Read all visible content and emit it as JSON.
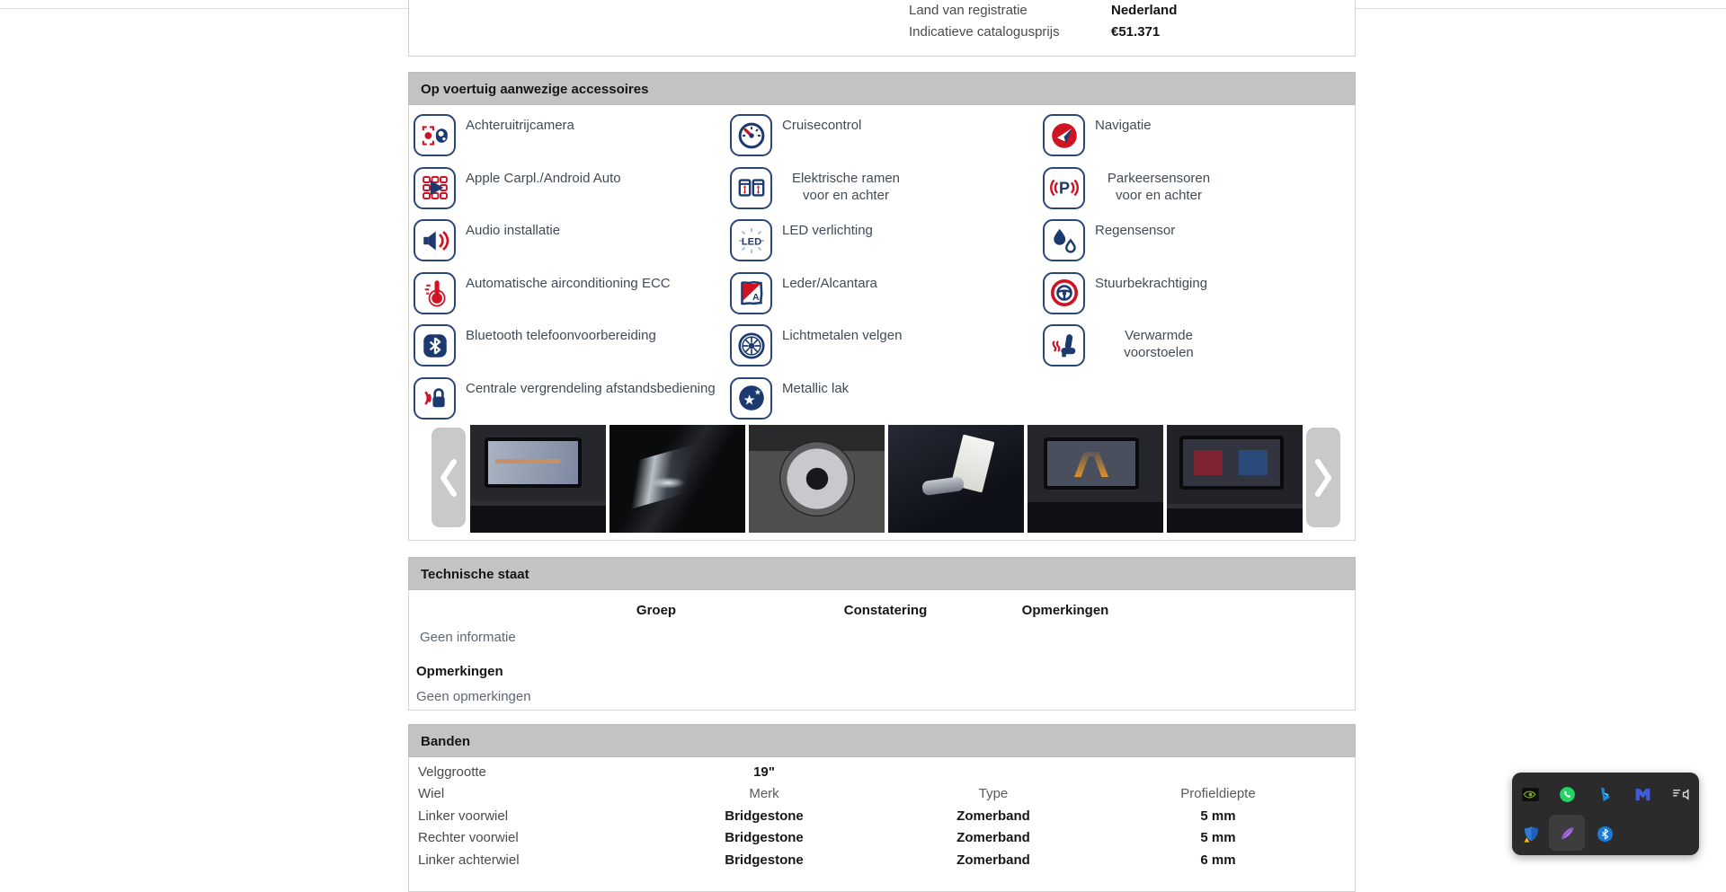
{
  "info_panel": {
    "rows": [
      {
        "label": "Land van registratie",
        "value": "Nederland"
      },
      {
        "label": "Indicatieve catalogusprijs",
        "value": "€51.371"
      }
    ]
  },
  "accessories": {
    "title": "Op voertuig aanwezige accessoires",
    "columns": [
      [
        {
          "label": "Achteruitrijcamera",
          "icon": "rear-camera-icon"
        },
        {
          "label": "Apple Carpl./Android Auto",
          "icon": "carplay-icon"
        },
        {
          "label": "Audio installatie",
          "icon": "audio-speaker-icon"
        },
        {
          "label": "Automatische airconditioning ECC",
          "icon": "climate-thermometer-icon"
        },
        {
          "label": "Bluetooth telefoonvoorbereiding",
          "icon": "bluetooth-icon"
        },
        {
          "label": "Centrale vergrendeling afstandsbediening",
          "icon": "remote-lock-icon"
        }
      ],
      [
        {
          "label": "Cruisecontrol",
          "icon": "cruise-gauge-icon"
        },
        {
          "label": "Elektrische ramen voor en achter",
          "icon": "electric-windows-icon"
        },
        {
          "label": "LED verlichting",
          "icon": "led-light-icon"
        },
        {
          "label": "Leder/Alcantara",
          "icon": "leather-icon"
        },
        {
          "label": "Lichtmetalen velgen",
          "icon": "alloy-wheel-icon"
        },
        {
          "label": "Metallic lak",
          "icon": "metallic-paint-icon"
        }
      ],
      [
        {
          "label": "Navigatie",
          "icon": "navigation-icon"
        },
        {
          "label": "Parkeersensoren voor en achter",
          "icon": "parking-sensors-icon"
        },
        {
          "label": "Regensensor",
          "icon": "rain-sensor-icon"
        },
        {
          "label": "Stuurbekrachtiging",
          "icon": "steering-wheel-icon"
        },
        {
          "label": "Verwarmde voorstoelen",
          "icon": "heated-seat-icon"
        }
      ]
    ]
  },
  "carousel": {
    "photos": [
      "dashboard-navigation-photo",
      "headlight-photo",
      "alloy-wheel-photo",
      "car-key-photo",
      "parking-camera-photo",
      "dashboard-display-photo"
    ]
  },
  "technical": {
    "title": "Technische staat",
    "headers": [
      "Groep",
      "Constatering",
      "Opmerkingen"
    ],
    "no_info": "Geen informatie",
    "remarks_title": "Opmerkingen",
    "no_remarks": "Geen opmerkingen"
  },
  "tyres": {
    "title": "Banden",
    "size_label": "Velggrootte",
    "size_value": "19\"",
    "headers": [
      "Wiel",
      "Merk",
      "Type",
      "Profieldiepte"
    ],
    "rows": [
      {
        "wheel": "Linker voorwiel",
        "brand": "Bridgestone",
        "type": "Zomerband",
        "depth": "5 mm"
      },
      {
        "wheel": "Rechter voorwiel",
        "brand": "Bridgestone",
        "type": "Zomerband",
        "depth": "5 mm"
      },
      {
        "wheel": "Linker achterwiel",
        "brand": "Bridgestone",
        "type": "Zomerband",
        "depth": "6 mm"
      }
    ]
  },
  "tray": {
    "row1": [
      "nvidia-icon",
      "whatsapp-icon",
      "bing-icon",
      "malwarebytes-icon",
      "volume-lines-icon"
    ],
    "row2": [
      "windows-security-warning-icon",
      "lightshot-feather-icon",
      "bluetooth-tray-icon"
    ]
  },
  "colors": {
    "accent_navy": "#1d3a70",
    "accent_red": "#cf1322",
    "section_header_bg": "#c3c3c3"
  }
}
